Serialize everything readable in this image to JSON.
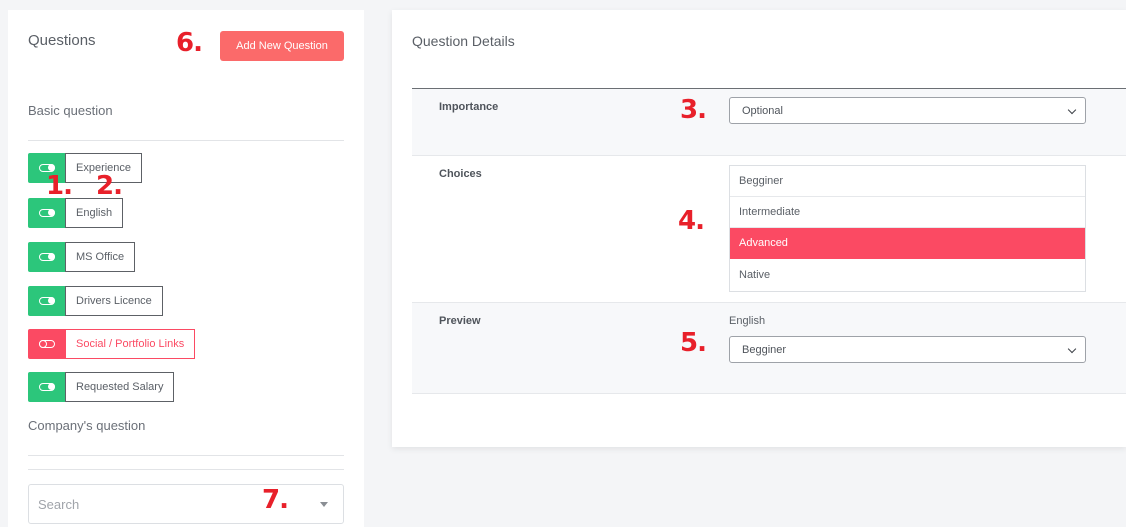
{
  "left": {
    "title": "Questions",
    "add_button": "Add New Question",
    "basic_section": "Basic question",
    "toggles": [
      {
        "label": "Experience",
        "on": true
      },
      {
        "label": "English",
        "on": true
      },
      {
        "label": "MS Office",
        "on": true
      },
      {
        "label": "Drivers Licence",
        "on": true
      },
      {
        "label": "Social / Portfolio Links",
        "on": false
      },
      {
        "label": "Requested Salary",
        "on": true
      }
    ],
    "company_section": "Company's question",
    "search_placeholder": "Search"
  },
  "details": {
    "title": "Question Details",
    "importance_label": "Importance",
    "importance_value": "Optional",
    "choices_label": "Choices",
    "choices": [
      "Begginer",
      "Intermediate",
      "Advanced",
      "Native"
    ],
    "selected_choice": "Advanced",
    "preview_label": "Preview",
    "preview_question": "English",
    "preview_value": "Begginer"
  },
  "annotations": [
    "1.",
    "2.",
    "3.",
    "4.",
    "5.",
    "6.",
    "7."
  ],
  "colors": {
    "toggle_on": "#2cc67b",
    "toggle_off": "#fb4a63",
    "add_button": "#fb6a6a",
    "selected_choice": "#fb4a63",
    "annotation": "#e8202a"
  }
}
